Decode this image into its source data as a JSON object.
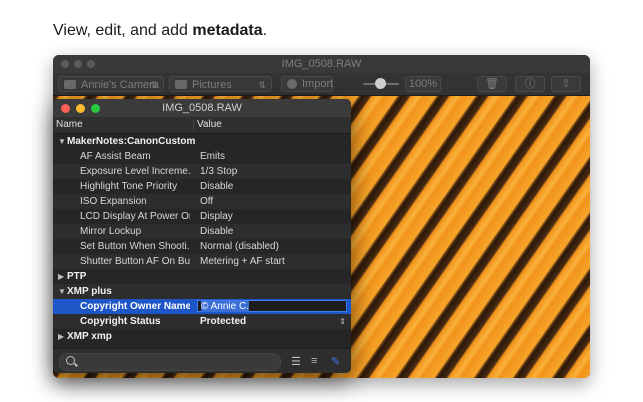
{
  "headline": {
    "prefix": "View, edit, and add ",
    "bold": "metadata",
    "suffix": "."
  },
  "app": {
    "title": "IMG_0508.RAW",
    "camera_label": "Annie's Camera",
    "folder_label": "Pictures",
    "import_label": "Import",
    "zoom_label": "100%",
    "icons": [
      "camera-icon",
      "folder-icon",
      "import-icon",
      "trash-icon",
      "info-icon",
      "share-icon"
    ]
  },
  "panel": {
    "title": "IMG_0508.RAW",
    "columns": {
      "name": "Name",
      "value": "Value"
    },
    "groups": {
      "makernotes": "MakerNotes:CanonCustom",
      "ptp": "PTP",
      "xmp_plus": "XMP plus",
      "xmp_xmp": "XMP xmp"
    },
    "makernote_rows": [
      {
        "key": "AF Assist Beam",
        "value": "Emits"
      },
      {
        "key": "Exposure Level Increme...",
        "value": "1/3 Stop"
      },
      {
        "key": "Highlight Tone Priority",
        "value": "Disable"
      },
      {
        "key": "ISO Expansion",
        "value": "Off"
      },
      {
        "key": "LCD Display At Power On",
        "value": "Display"
      },
      {
        "key": "Mirror Lockup",
        "value": "Disable"
      },
      {
        "key": "Set Button When Shooti...",
        "value": "Normal (disabled)"
      },
      {
        "key": "Shutter Button AF On Bu...",
        "value": "Metering + AF start"
      }
    ],
    "xmp_rows": {
      "copyright_owner_key": "Copyright Owner Name",
      "copyright_owner_value": "© Annie C.",
      "copyright_status_key": "Copyright Status",
      "copyright_status_value": "Protected"
    },
    "search_placeholder": ""
  },
  "colors": {
    "selection": "#1f56c7",
    "panel_bg": "#262626",
    "accent": "#3f7cf0"
  }
}
